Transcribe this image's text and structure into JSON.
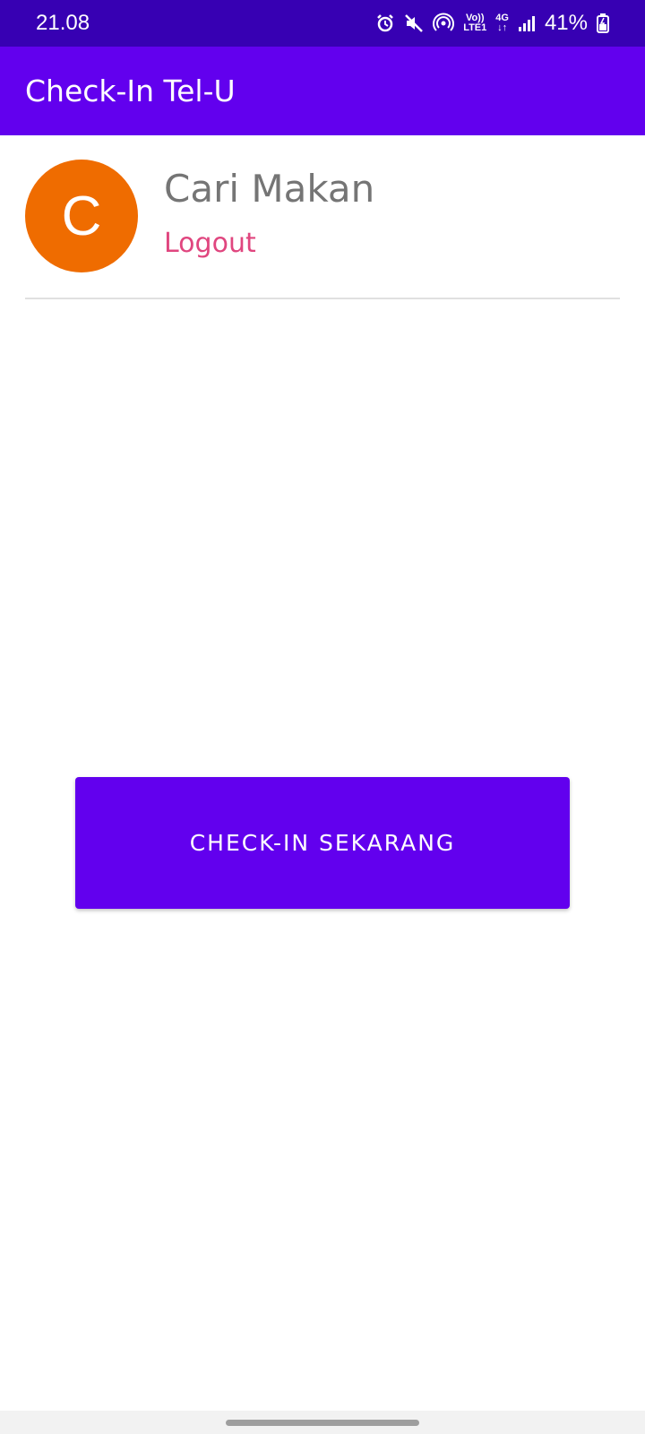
{
  "status_bar": {
    "time": "21.08",
    "icons": [
      "alarm-icon",
      "mute-icon",
      "hotspot-icon",
      "volte-icon",
      "4g-icon",
      "signal-icon",
      "battery-icon"
    ],
    "volte_top": "Vo))",
    "volte_bottom": "LTE1",
    "network_top": "4G",
    "network_bottom": "↓↑",
    "battery": "41%"
  },
  "app_bar": {
    "title": "Check-In Tel-U"
  },
  "profile": {
    "avatar_letter": "C",
    "name": "Cari Makan",
    "logout_label": "Logout"
  },
  "actions": {
    "checkin_label": "CHECK-IN SEKARANG"
  },
  "colors": {
    "status_bar": "#3700b3",
    "primary": "#6200ee",
    "avatar": "#ef6c00",
    "logout": "#e0467f",
    "name_text": "#757575"
  }
}
